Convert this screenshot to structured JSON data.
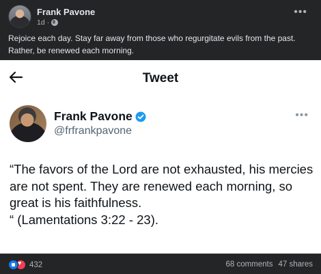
{
  "post": {
    "author": "Frank Pavone",
    "time": "1d",
    "caption_line1": "Rejoice each day. Stay far away from those who regurgitate evils from the past.",
    "caption_line2": "Rather, be renewed each morning.",
    "more_icon": "more-horizontal-icon"
  },
  "tweet": {
    "heading": "Tweet",
    "name": "Frank Pavone",
    "handle": "@frfrankpavone",
    "verified_color": "#1d9bf0",
    "body": "“The favors of the Lord are not exhausted, his mercies are not spent. They are renewed each morning, so great is his faithfulness.\n“ (Lamentations 3:22 - 23)."
  },
  "footer": {
    "reaction_count": "432",
    "comments": "68 comments",
    "shares": "47 shares"
  },
  "colors": {
    "fb_dark": "#242526",
    "fb_text": "#e4e6eb",
    "fb_secondary": "#b0b3b8",
    "like_blue": "#1877f2",
    "love_red": "#f33e58"
  }
}
